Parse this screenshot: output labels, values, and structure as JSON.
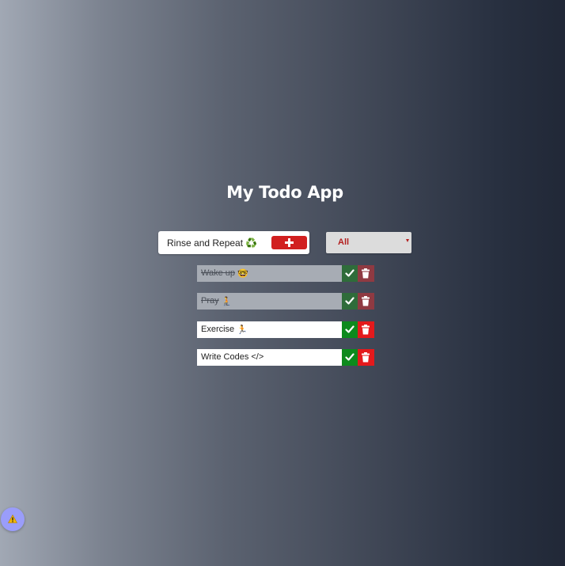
{
  "app": {
    "title": "My Todo App"
  },
  "form": {
    "input_value": "Rinse and Repeat ♻️",
    "add_icon": "plus-icon"
  },
  "filter": {
    "selected": "All",
    "arrow_icon": "caret-down-icon"
  },
  "todos": [
    {
      "text": "Wake up",
      "emoji": "🤓",
      "emoji_icon": "nerd-face-icon",
      "completed": true
    },
    {
      "text": "Pray",
      "emoji": "🧎",
      "emoji_icon": "kneeling-person-icon",
      "completed": true
    },
    {
      "text": "Exercise",
      "emoji": "🏃",
      "emoji_icon": "running-person-icon",
      "completed": false
    },
    {
      "text": "Write Codes </>",
      "emoji": "",
      "emoji_icon": "",
      "completed": false
    }
  ],
  "actions": {
    "complete_icon": "check-icon",
    "delete_icon": "trash-icon"
  },
  "floating_button": {
    "icon": "warning-icon"
  },
  "colors": {
    "accent_red": "#d11f1f",
    "complete_green": "#0d8a1d",
    "trash_red": "#e4191c",
    "completed_row": "#a7acb4",
    "fab_purple": "#9a9dfa"
  }
}
